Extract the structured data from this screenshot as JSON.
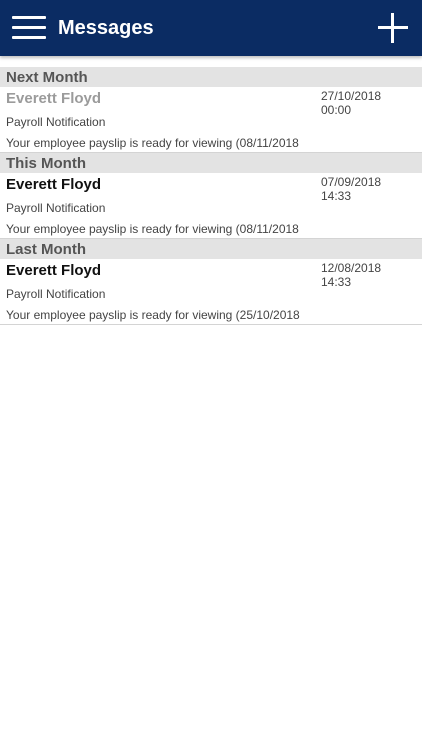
{
  "header": {
    "title": "Messages",
    "menu_icon": "hamburger-menu-icon",
    "add_icon": "plus-icon"
  },
  "colors": {
    "app_bar": "#0b2c63",
    "section_header": "#e3e3e3"
  },
  "sections": [
    {
      "title": "Next Month",
      "messages": [
        {
          "sender": "Everett Floyd",
          "date": "27/10/2018",
          "time": "00:00",
          "subject": "Payroll Notification",
          "preview": "Your employee payslip is ready for viewing (08/11/2018"
        }
      ]
    },
    {
      "title": "This Month",
      "messages": [
        {
          "sender": "Everett Floyd",
          "date": "07/09/2018",
          "time": "14:33",
          "subject": "Payroll Notification",
          "preview": "Your employee payslip is ready for viewing (08/11/2018"
        }
      ]
    },
    {
      "title": "Last Month",
      "messages": [
        {
          "sender": "Everett Floyd",
          "date": "12/08/2018",
          "time": "14:33",
          "subject": "Payroll Notification",
          "preview": "Your employee payslip is ready for viewing (25/10/2018"
        }
      ]
    }
  ]
}
